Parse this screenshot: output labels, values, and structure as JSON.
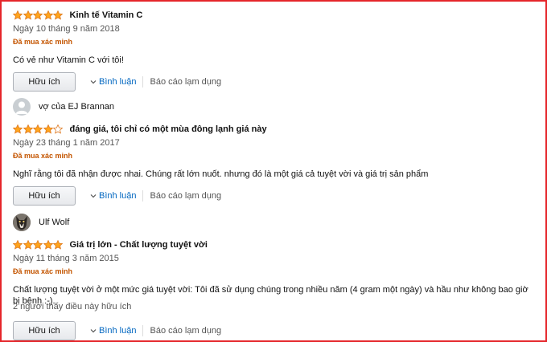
{
  "colors": {
    "star": "#ffa41c",
    "star_empty": "#ffffff",
    "star_outline": "#de7921",
    "verified": "#c45500",
    "link": "#0066c0",
    "frame_border": "#e5252a"
  },
  "reviews": [
    {
      "author": "",
      "avatar": "",
      "rating": 5,
      "title": "Kinh tế Vitamin C",
      "date": "Ngày 10 tháng 9 năm 2018",
      "verified": "Đã mua xác minh",
      "body": "Có vẻ như Vitamin C với tôi!",
      "helpful_count": "",
      "helpful_label": "Hữu ích",
      "comment_label": "Bình luận",
      "report_label": "Báo cáo lạm dụng"
    },
    {
      "author": "vợ của EJ Brannan",
      "avatar": "generic-user-icon",
      "rating": 4,
      "title": "đáng giá, tôi chỉ có một mùa đông lạnh giá này",
      "date": "Ngày 23 tháng 1 năm 2017",
      "verified": "Đã mua xác minh",
      "body": "Nghĩ rằng tôi đã nhận được nhai. Chúng rất lớn nuốt. nhưng đó là một giá cả tuyệt vời và giá trị sản phẩm",
      "helpful_count": "",
      "helpful_label": "Hữu ích",
      "comment_label": "Bình luận",
      "report_label": "Báo cáo lạm dụng"
    },
    {
      "author": "Ulf Wolf",
      "avatar": "dog-avatar-icon",
      "rating": 5,
      "title": "Giá trị lớn - Chất lượng tuyệt vời",
      "date": "Ngày 11 tháng 3 năm 2015",
      "verified": "Đã mua xác minh",
      "body": "Chất lượng tuyệt vời ở một mức giá tuyệt vời: Tôi đã sử dụng chúng trong nhiều năm (4 gram một ngày) và hầu như không bao giờ bị bệnh :-).",
      "helpful_count": "2 người thấy điều này hữu ích",
      "helpful_label": "Hữu ích",
      "comment_label": "Bình luận",
      "report_label": "Báo cáo lạm dụng"
    }
  ]
}
